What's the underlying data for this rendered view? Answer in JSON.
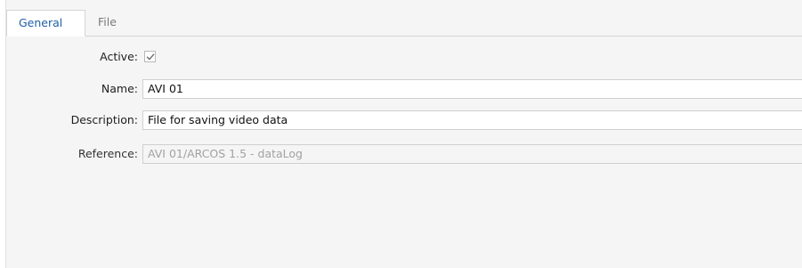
{
  "tabs": {
    "general": "General",
    "file": "File"
  },
  "form": {
    "active": {
      "label": "Active:",
      "checked": true
    },
    "name": {
      "label": "Name:",
      "value": "AVI 01"
    },
    "description": {
      "label": "Description:",
      "value": "File for saving video data"
    },
    "reference": {
      "label": "Reference:",
      "value": "AVI 01/ARCOS 1.5 - dataLog",
      "readonly": true
    }
  },
  "icons": {
    "checkbox": "checkmark-icon"
  },
  "colors": {
    "active_tab_text": "#1f5fa6",
    "panel_background": "#f5f5f5",
    "readonly_text": "#a2a2a2"
  }
}
